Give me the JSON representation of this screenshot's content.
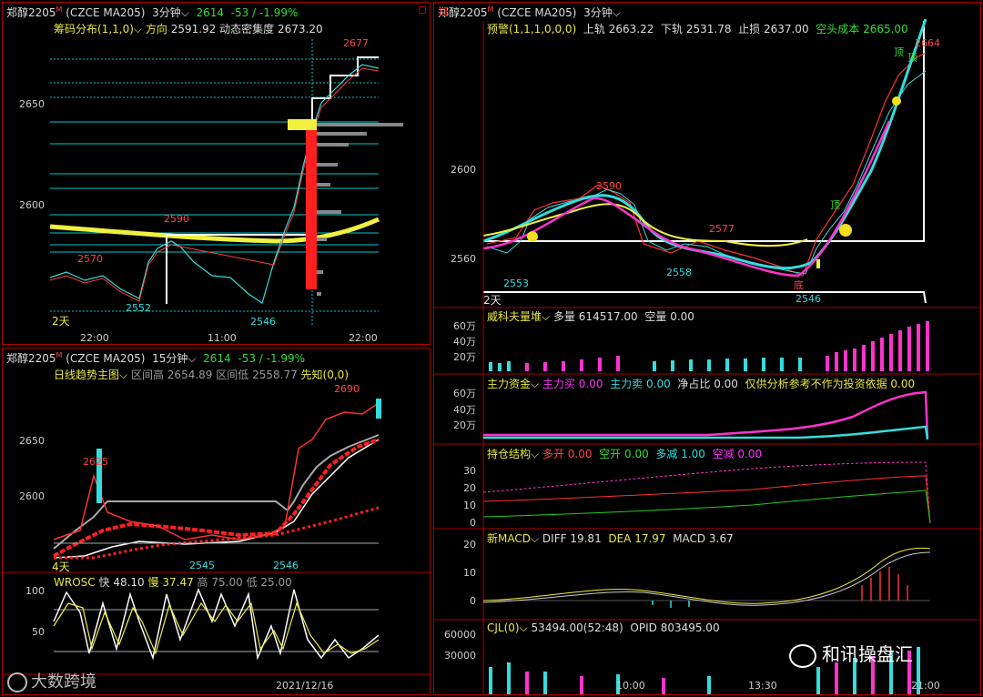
{
  "colors": {
    "up": "#ff3030",
    "down": "#33dddd",
    "yellow": "#f0f040",
    "magenta": "#ff33cc",
    "white": "#ffffff",
    "green": "#22cc22"
  },
  "p1": {
    "symbol": "郑醇2205",
    "sup": "M",
    "code": "(CZCE MA205)",
    "period": "3分钟",
    "price": "2614",
    "change": "-53 / -1.99%",
    "ind": "筹码分布(1,1,0)",
    "dir_label": "方向",
    "dir_val": "2591.92",
    "dens_label": "动态密集度",
    "dens_val": "2673.20",
    "yticks": [
      "2650",
      "2600"
    ],
    "xticks": [
      "22:00",
      "11:00",
      "22:00"
    ],
    "labels": {
      "hi": "2677",
      "l2590": "2590",
      "l2570": "2570",
      "l2552": "2552",
      "l2546": "2546",
      "days": "2天"
    }
  },
  "p2": {
    "symbol": "郑醇2205",
    "sup": "M",
    "code": "(CZCE MA205)",
    "period": "15分钟",
    "price": "2614",
    "change": "-53 / -1.99%",
    "ind": "日线趋势主图",
    "hi_label": "区间高",
    "hi_val": "2654.89",
    "lo_label": "区间低",
    "lo_val": "2558.77",
    "xz": "先知(0,0)",
    "yticks": [
      "2650",
      "2600"
    ],
    "labels": {
      "l2690": "2690",
      "l2625": "2625",
      "l2545": "2545",
      "l2546": "2546",
      "days": "4天"
    },
    "osc": {
      "name": "WROSC",
      "fast_label": "快",
      "fast": "48.10",
      "slow_label": "慢",
      "slow": "37.47",
      "high_label": "高",
      "high": "75.00",
      "low_label": "低",
      "low": "25.00",
      "yticks": [
        "100",
        "50"
      ],
      "date": "2021/12/16"
    }
  },
  "p3": {
    "symbol": "郑醇2205",
    "sup": "M",
    "code": "(CZCE MA205)",
    "period": "3分钟",
    "ind": "预警(1,1,1,0,0,0)",
    "up_label": "上轨",
    "up_val": "2663.22",
    "dn_label": "下轨",
    "dn_val": "2531.78",
    "stop_label": "止损",
    "stop_val": "2637.00",
    "cost_label": "空头成本",
    "cost_val": "2665.00",
    "yticks": [
      "2600",
      "2560"
    ],
    "labels": {
      "l2664": "2664",
      "l2590": "2590",
      "l2577": "2577",
      "l2558": "2558",
      "l2553": "2553",
      "l2546": "2546",
      "days": "2天",
      "top1": "顶",
      "top2": "顶",
      "top3": "顶",
      "bottom1": "底"
    }
  },
  "vol": {
    "name": "威科夫量堆",
    "many_label": "多量",
    "many": "614517.00",
    "empty_label": "空量",
    "empty": "0.00",
    "yticks": [
      "60万",
      "40万",
      "20万"
    ]
  },
  "fund": {
    "name": "主力资金",
    "buy_label": "主力买",
    "buy": "0.00",
    "sell_label": "主力卖",
    "sell": "0.00",
    "net_label": "净占比",
    "net": "0.00",
    "note": "仅供分析参考不作为投资依据",
    "note_val": "0.00",
    "yticks": [
      "60万",
      "40万",
      "20万"
    ]
  },
  "pos": {
    "name": "持仓结构",
    "a_label": "多开",
    "a": "0.00",
    "b_label": "空开",
    "b": "0.00",
    "c_label": "多减",
    "c": "1.00",
    "d_label": "空减",
    "d": "0.00",
    "yticks": [
      "30",
      "20",
      "10",
      "0"
    ]
  },
  "macd": {
    "name": "新MACD",
    "diff_label": "DIFF",
    "diff": "19.81",
    "dea_label": "DEA",
    "dea": "17.97",
    "macd_label": "MACD",
    "macd": "3.67",
    "yticks": [
      "20",
      "10",
      "0"
    ]
  },
  "cjl": {
    "name": "CJL(0)",
    "val": "53494.00(52:48)",
    "opid_label": "OPID",
    "opid": "803495.00",
    "yticks": [
      "60000",
      "30000"
    ],
    "xticks": [
      "10:00",
      "13:30",
      "21:00"
    ]
  },
  "watermarks": {
    "left": "大数跨境",
    "right": "和讯操盘汇"
  }
}
